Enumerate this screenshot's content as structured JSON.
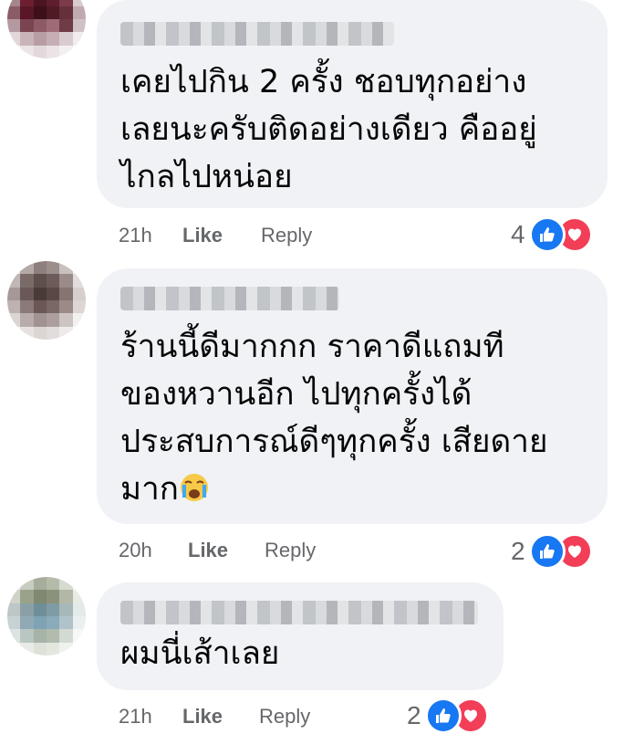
{
  "comments": [
    {
      "text": "เคยไปกิน 2 ครั้ง ชอบทุกอย่าง\nเลยนะครับติดอย่างเดียว คืออยู่\nไกลไปหน่อย",
      "time": "21h",
      "like_label": "Like",
      "reply_label": "Reply",
      "reaction_count": "4",
      "reactions": [
        "like-icon",
        "love-icon"
      ]
    },
    {
      "text": "ร้านนี้ดีมากกก ราคาดีแถมที\nของหวานอีก ไปทุกครั้งได้\nประสบการณ์ดีๆทุกครั้ง เสียดาย\nมาก",
      "emoji": "crying-face-icon",
      "time": "20h",
      "like_label": "Like",
      "reply_label": "Reply",
      "reaction_count": "2",
      "reactions": [
        "like-icon",
        "love-icon"
      ]
    },
    {
      "text": "ผมนี่เส้าเลย",
      "time": "21h",
      "like_label": "Like",
      "reply_label": "Reply",
      "reaction_count": "2",
      "reactions": [
        "like-icon",
        "love-icon"
      ]
    }
  ],
  "colors": {
    "like": "#1877f2",
    "love": "#f33e58",
    "bubble": "#f0f2f5",
    "meta": "#65676b"
  }
}
